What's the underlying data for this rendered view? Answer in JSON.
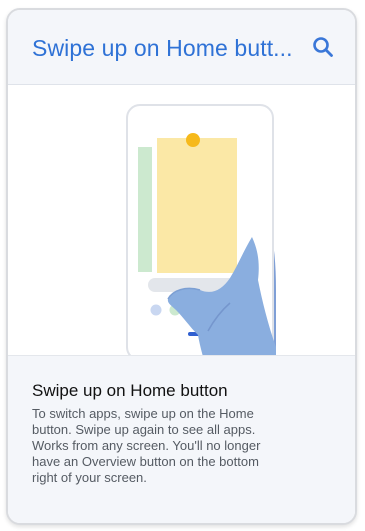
{
  "header": {
    "title": "Swipe up on Home butt...",
    "search_icon": "search-icon"
  },
  "tip": {
    "title": "Swipe up on Home button",
    "lines": [
      "To switch apps, swipe up on the Home",
      "button. Swipe up again to see all apps.",
      "Works from any screen. You'll no longer",
      "have an Overview button on the bottom",
      "right of your screen."
    ]
  },
  "colors": {
    "accent": "#2f72d6",
    "header_bg": "#f4f6fa",
    "card_yellow": "#fbe8a6",
    "side_card_green": "#cce9cf",
    "hand_blue": "#8aaedf",
    "home_pill": "#2f5fd0"
  }
}
